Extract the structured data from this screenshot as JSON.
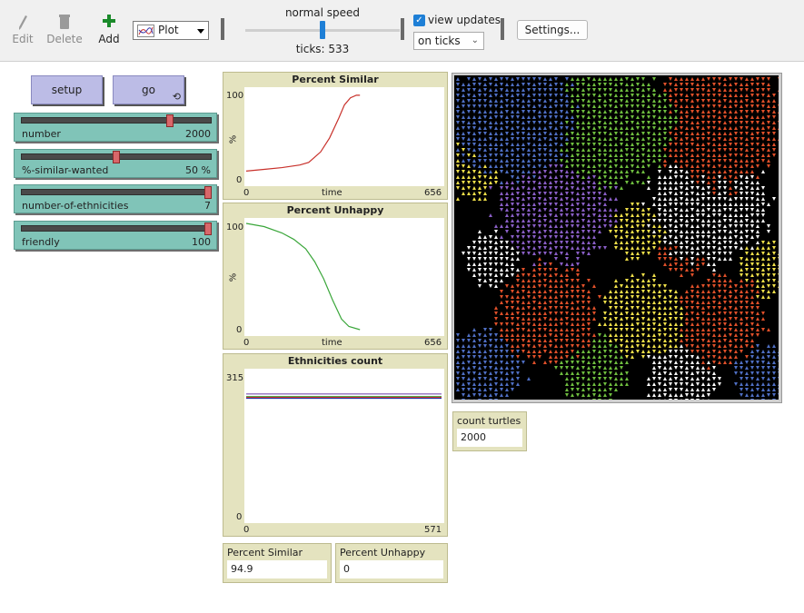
{
  "toolbar": {
    "edit": "Edit",
    "delete": "Delete",
    "add": "Add",
    "widget_type": "Plot",
    "speed_label": "normal speed",
    "speed_value": 0.5,
    "ticks": "ticks: 533",
    "view_updates": "view updates",
    "update_mode": "on ticks",
    "settings": "Settings..."
  },
  "buttons": {
    "setup": "setup",
    "go": "go"
  },
  "sliders": [
    {
      "name": "number",
      "value": "2000",
      "fraction": 0.79
    },
    {
      "name": "%-similar-wanted",
      "value": "50 %",
      "fraction": 0.5
    },
    {
      "name": "number-of-ethnicities",
      "value": "7",
      "fraction": 1.0
    },
    {
      "name": "friendly",
      "value": "100",
      "fraction": 1.0
    }
  ],
  "plots": {
    "similar": {
      "title": "Percent Similar",
      "y_max": "100",
      "y_min": "0",
      "x_min": "0",
      "x_max": "656",
      "xlabel": "time",
      "ylabel": "%",
      "color": "#c8302a"
    },
    "unhappy": {
      "title": "Percent Unhappy",
      "y_max": "100",
      "y_min": "0",
      "x_min": "0",
      "x_max": "656",
      "xlabel": "time",
      "ylabel": "%",
      "color": "#3aa63a"
    },
    "ethnicities": {
      "title": "Ethnicities count",
      "y_max": "315",
      "y_min": "0",
      "x_min": "0",
      "x_max": "571"
    }
  },
  "chart_data": [
    {
      "type": "line",
      "title": "Percent Similar",
      "xlabel": "time",
      "ylabel": "%",
      "xlim": [
        0,
        656
      ],
      "ylim": [
        0,
        100
      ],
      "series": [
        {
          "values": [
            [
              0,
              10
            ],
            [
              60,
              12
            ],
            [
              120,
              14
            ],
            [
              180,
              17
            ],
            [
              210,
              20
            ],
            [
              250,
              32
            ],
            [
              280,
              48
            ],
            [
              310,
              70
            ],
            [
              330,
              86
            ],
            [
              350,
              94
            ],
            [
              370,
              97
            ],
            [
              382,
              97
            ]
          ]
        }
      ]
    },
    {
      "type": "line",
      "title": "Percent Unhappy",
      "xlabel": "time",
      "ylabel": "%",
      "xlim": [
        0,
        656
      ],
      "ylim": [
        0,
        100
      ],
      "series": [
        {
          "values": [
            [
              0,
              100
            ],
            [
              60,
              97
            ],
            [
              120,
              91
            ],
            [
              160,
              85
            ],
            [
              200,
              76
            ],
            [
              230,
              64
            ],
            [
              260,
              48
            ],
            [
              290,
              28
            ],
            [
              320,
              10
            ],
            [
              345,
              3
            ],
            [
              382,
              0
            ]
          ]
        }
      ]
    },
    {
      "type": "line",
      "title": "Ethnicities count",
      "xlim": [
        0,
        571
      ],
      "ylim": [
        0,
        315
      ],
      "series": [
        {
          "values": [
            [
              0,
              286
            ],
            [
              571,
              286
            ]
          ],
          "color": "#7d52b3"
        },
        {
          "values": [
            [
              0,
              280
            ],
            [
              571,
              280
            ]
          ],
          "color": "#2f9d35"
        },
        {
          "values": [
            [
              0,
              278
            ],
            [
              571,
              278
            ]
          ],
          "color": "#d33a2a"
        },
        {
          "values": [
            [
              0,
              276
            ],
            [
              571,
              276
            ]
          ],
          "color": "#1f2fa0"
        }
      ]
    }
  ],
  "monitors": [
    {
      "label": "count turtles",
      "value": "2000"
    },
    {
      "label": "Percent Similar",
      "value": "94.9"
    },
    {
      "label": "Percent Unhappy",
      "value": "0"
    }
  ],
  "world": {
    "background": "#000000",
    "colors": {
      "blue": "#4f6fc4",
      "green": "#6fbe3f",
      "red": "#e0502a",
      "purple": "#8a5fc7",
      "yellow": "#f0e04a",
      "white": "#ffffff"
    }
  }
}
